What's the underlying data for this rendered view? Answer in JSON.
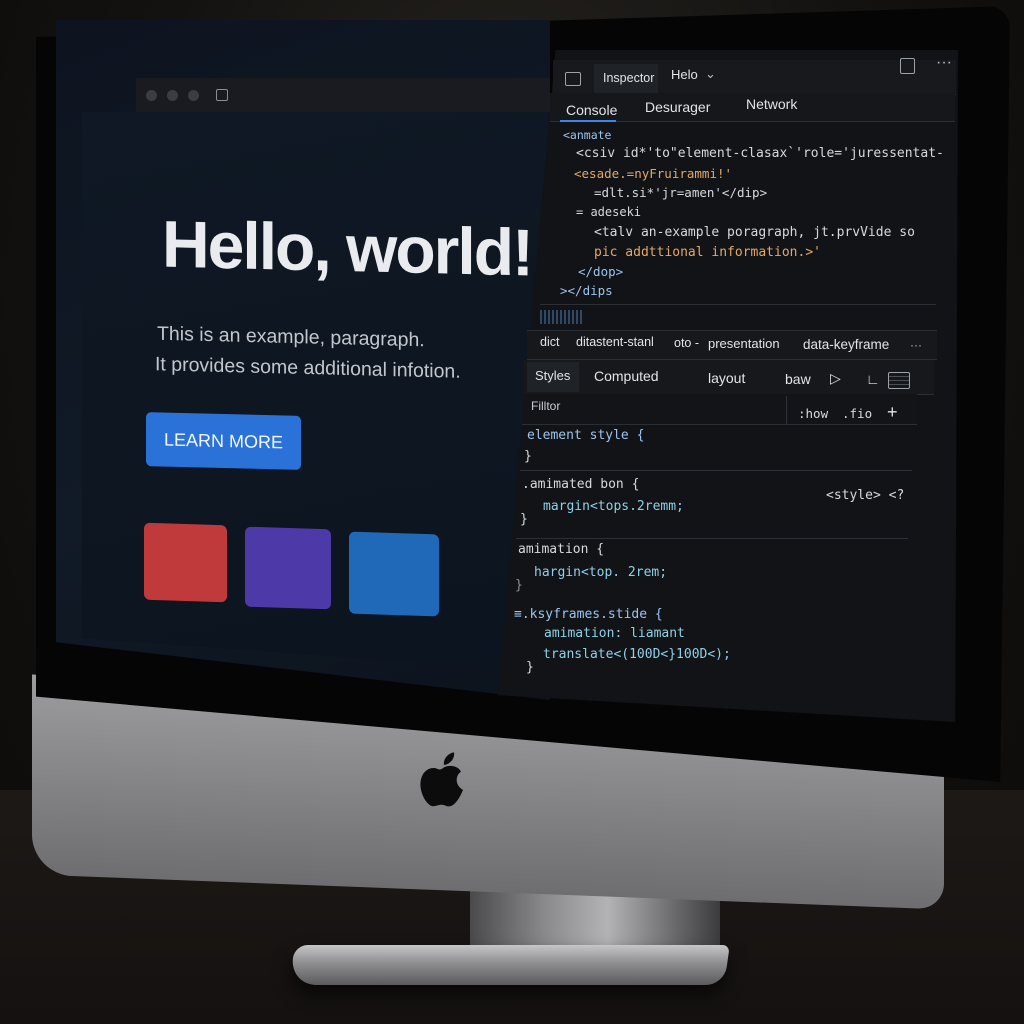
{
  "browser": {
    "heading": "Hello, world!",
    "paragraph_line1": "This is an example, paragraph.",
    "paragraph_line2": "It provides some additional infotion.",
    "button_label": "LEARN MORE",
    "swatches": [
      {
        "name": "red",
        "color": "#c0393b"
      },
      {
        "name": "purple",
        "color": "#4d3aa8"
      },
      {
        "name": "blue",
        "color": "#2068b8"
      }
    ]
  },
  "devtools": {
    "top_tabs": {
      "inspector": "Inspector",
      "helo": "Helo"
    },
    "sub_tabs": {
      "console": "Console",
      "debugger": "Desurager",
      "network": "Network"
    },
    "markup_lines": [
      "<anmate",
      "<csiv id*'to\"element-clasax`'role='juressentat-",
      "<esade.=nyFruirammi!'",
      "=dlt.si*'jr=amen'</dip>",
      "= adeseki",
      "<talv an-example poragraph, jt.prvVide so",
      "pic addttional information.>'",
      "</dop>",
      "></dips"
    ],
    "breadcrumbs": [
      "dict",
      "ditastent-stanl",
      "oto -",
      "presentation",
      "data-keyframe",
      "···"
    ],
    "styles_tabs": {
      "styles": "Styles",
      "computed": "Computed",
      "layout": "layout",
      "baw": "baw"
    },
    "filter": {
      "placeholder": "Filltor",
      "show": ":how",
      "fio": ".fio"
    },
    "rules": {
      "element_style": "element style {",
      "element_close": "}",
      "rule1_selector": ".amimated bon {",
      "rule1_source": "<style> <?",
      "rule1_decl": "margin<tops.2remm;",
      "rule1_close": "}",
      "rule2_selector": "amimation {",
      "rule2_decl": "hargin<top. 2rem;",
      "rule2_close": "}",
      "rule3_selector": "≡.ksyframes.stide {",
      "rule3_decl1": "amimation: liamant",
      "rule3_decl2": "translate<(100D<}100D<);",
      "rule3_close": "}"
    }
  },
  "colors": {
    "accent": "#2a72d8"
  }
}
